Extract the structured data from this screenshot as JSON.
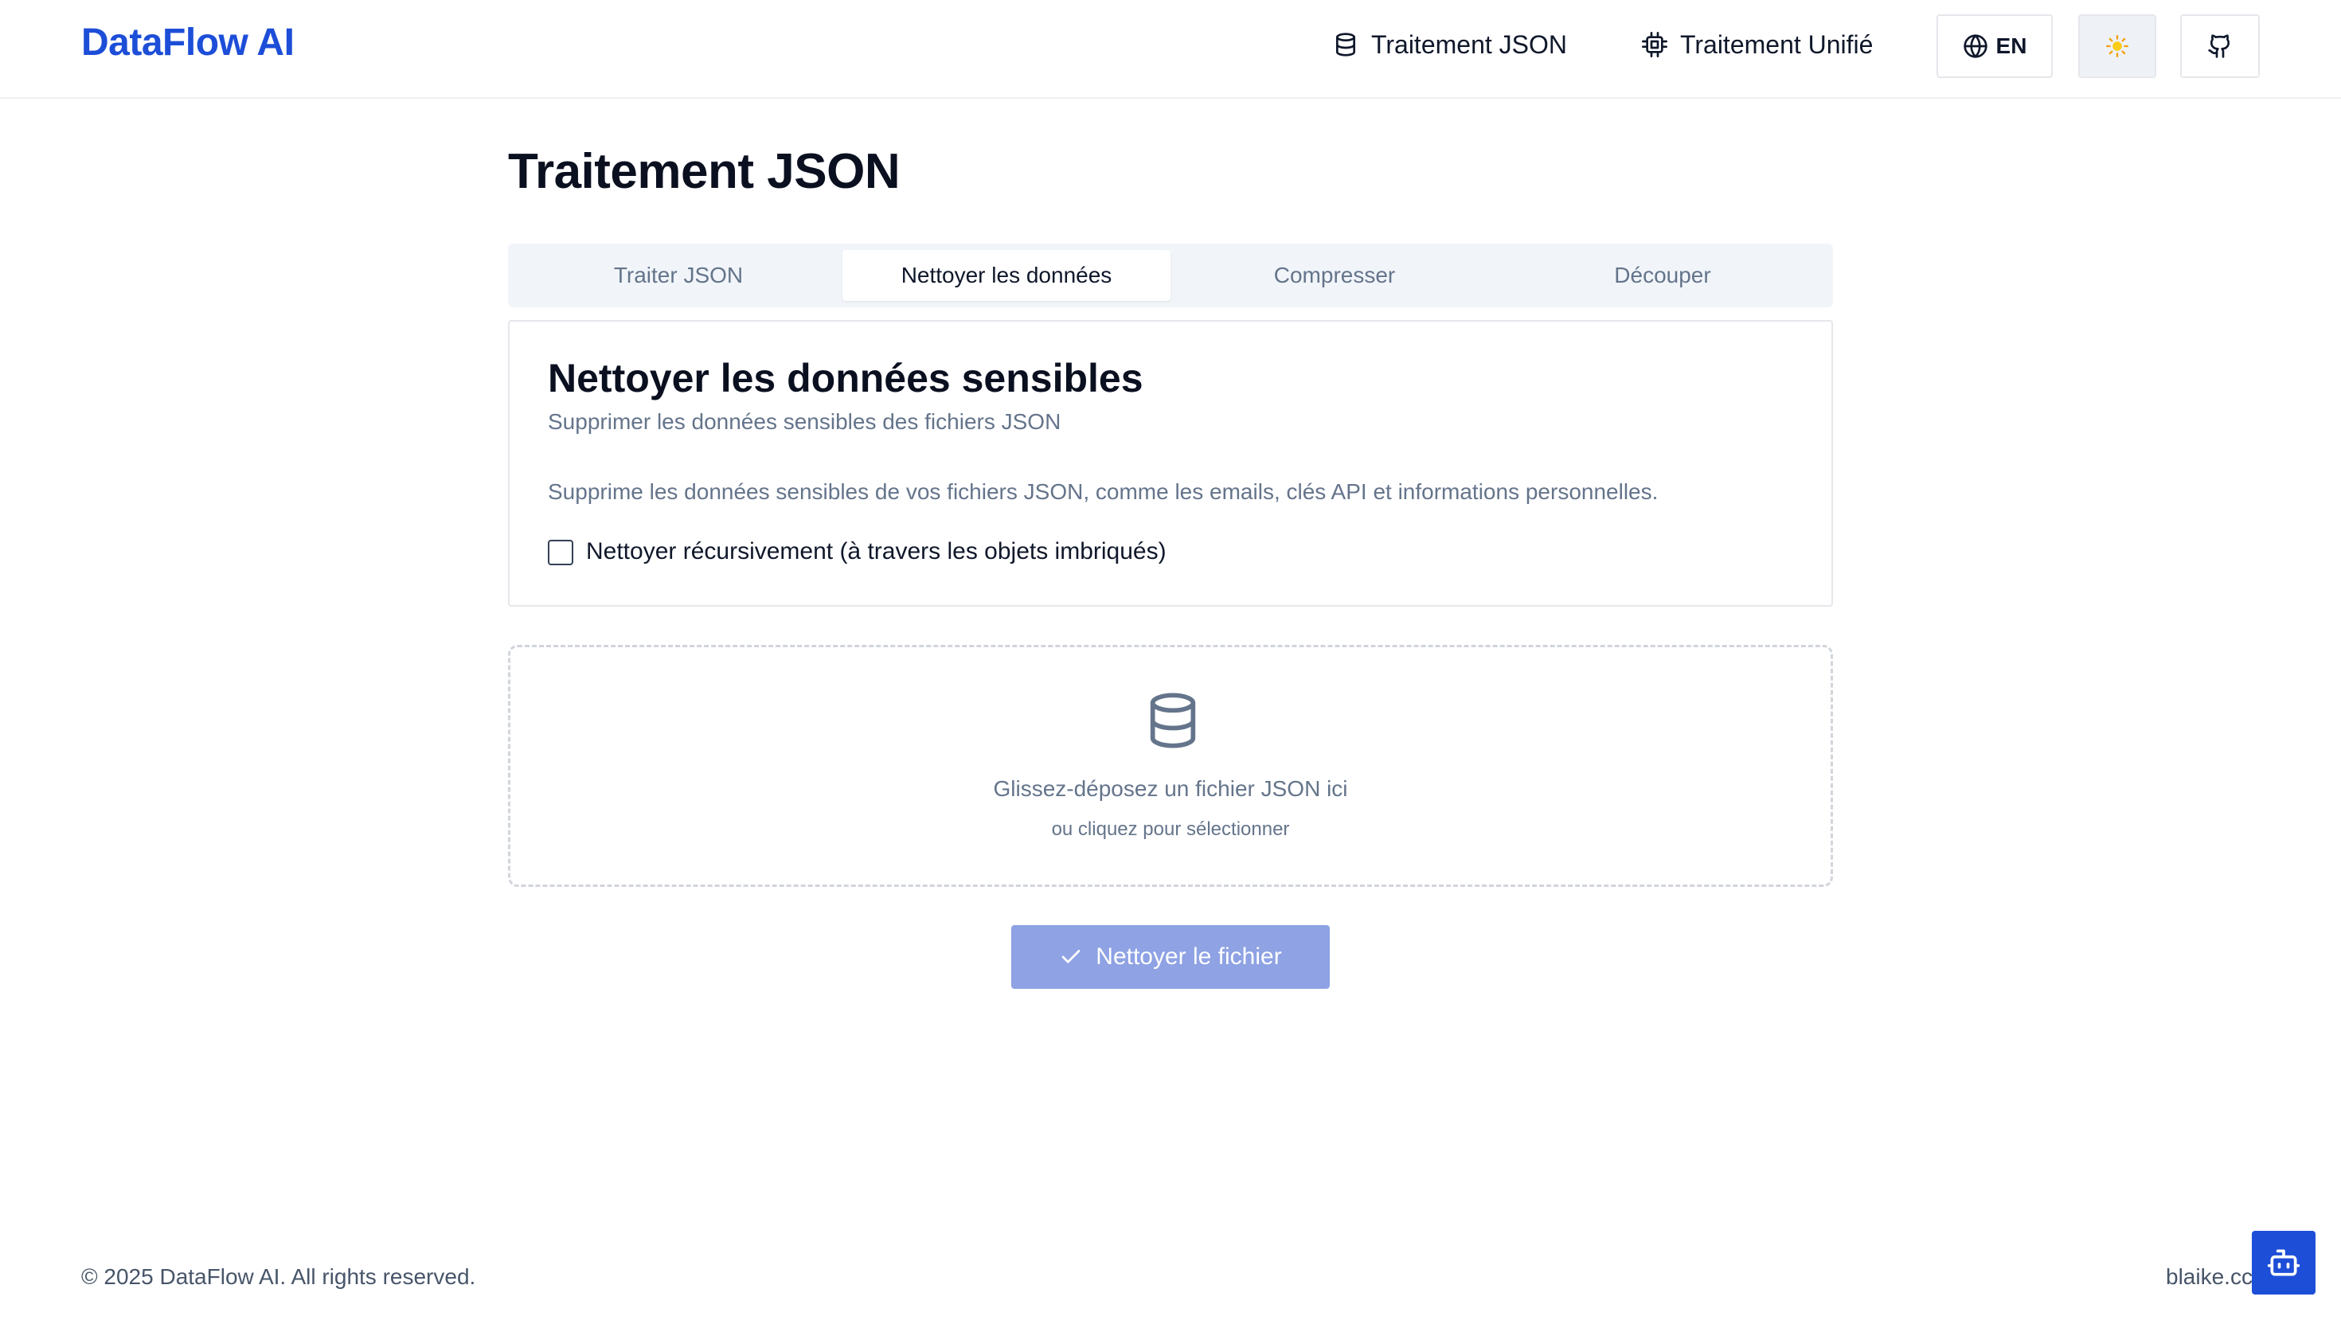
{
  "header": {
    "logo": "DataFlow AI",
    "nav": [
      {
        "label": "Traitement JSON",
        "icon": "database-icon"
      },
      {
        "label": "Traitement Unifié",
        "icon": "cpu-chip-icon"
      }
    ],
    "language_label": "EN",
    "language_icon": "globe-icon",
    "theme_icon": "sun-icon",
    "github_icon": "github-icon"
  },
  "page": {
    "title": "Traitement JSON"
  },
  "tabs": [
    {
      "label": "Traiter JSON",
      "active": false
    },
    {
      "label": "Nettoyer les données",
      "active": true
    },
    {
      "label": "Compresser",
      "active": false
    },
    {
      "label": "Découper",
      "active": false
    }
  ],
  "card": {
    "title": "Nettoyer les données sensibles",
    "subtitle": "Supprimer les données sensibles des fichiers JSON",
    "description": "Supprime les données sensibles de vos fichiers JSON, comme les emails, clés API et informations personnelles.",
    "checkbox_label": "Nettoyer récursivement (à travers les objets imbriqués)",
    "checkbox_checked": false
  },
  "dropzone": {
    "icon": "database-icon",
    "main_text": "Glissez-déposez un fichier JSON ici",
    "sub_text": "ou cliquez pour sélectionner"
  },
  "action": {
    "label": "Nettoyer le fichier",
    "icon": "check-icon"
  },
  "footer": {
    "copyright": "© 2025 DataFlow AI. All rights reserved.",
    "right_text": "blaike.cc",
    "bot_icon": "bot-icon"
  },
  "colors": {
    "brand": "#1d4ed8",
    "action_disabled": "#8ea2e4",
    "muted_text": "#64748b",
    "tab_bg": "#f1f5f9"
  }
}
